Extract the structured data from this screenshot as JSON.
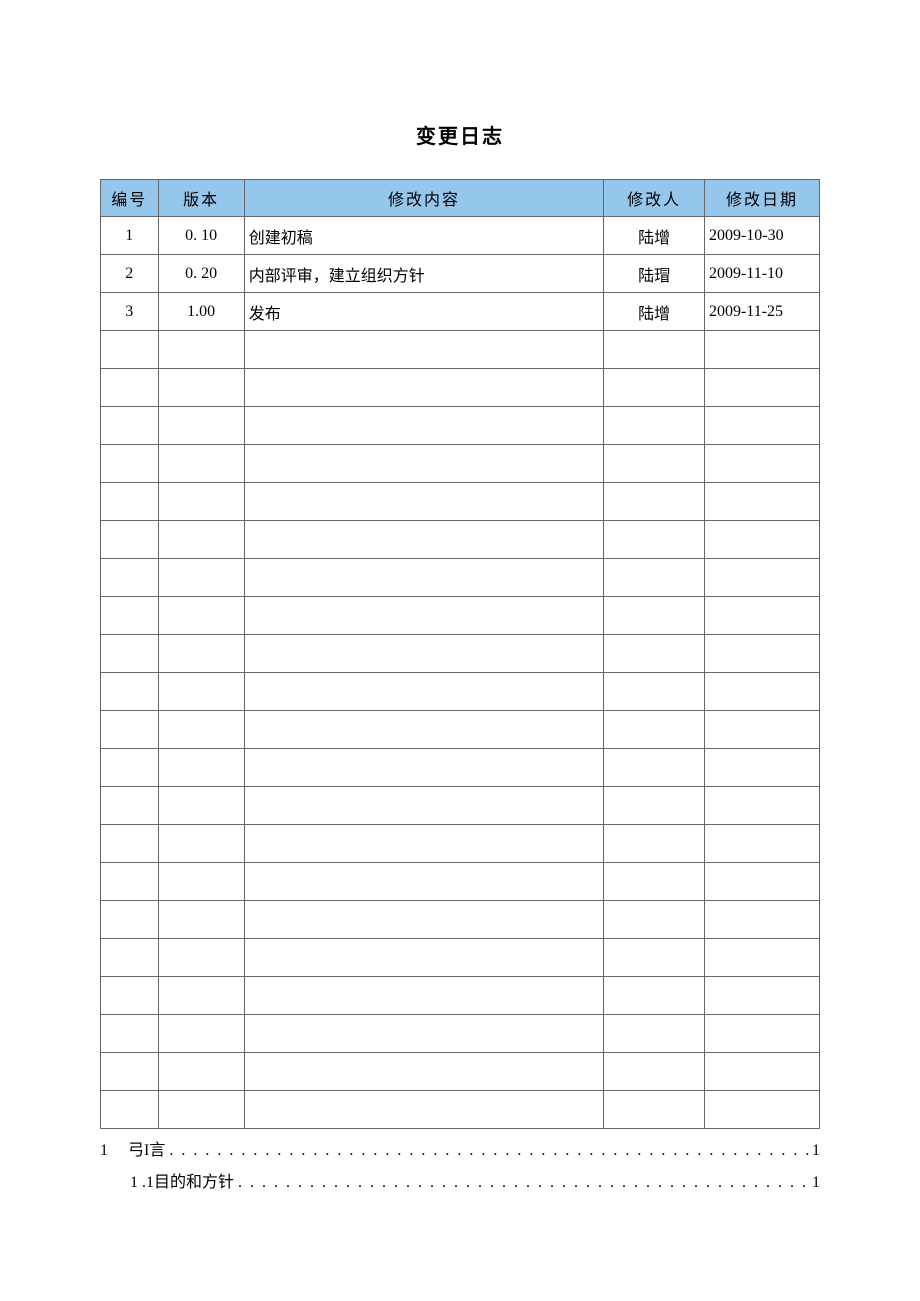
{
  "title": "变更日志",
  "table": {
    "headers": {
      "id": "编号",
      "version": "版本",
      "content": "修改内容",
      "author": "修改人",
      "date": "修改日期"
    },
    "rows": [
      {
        "id": "1",
        "version": "0. 10",
        "content": "创建初稿",
        "author": "陆增",
        "date": "2009-10-30"
      },
      {
        "id": "2",
        "version": "0. 20",
        "content": "内部评审，建立组织方针",
        "author": "陆瑁",
        "date": "2009-11-10"
      },
      {
        "id": "3",
        "version": "1.00",
        "content": "发布",
        "author": "陆增",
        "date": "2009-11-25"
      },
      {
        "id": "",
        "version": "",
        "content": "",
        "author": "",
        "date": ""
      },
      {
        "id": "",
        "version": "",
        "content": "",
        "author": "",
        "date": ""
      },
      {
        "id": "",
        "version": "",
        "content": "",
        "author": "",
        "date": ""
      },
      {
        "id": "",
        "version": "",
        "content": "",
        "author": "",
        "date": ""
      },
      {
        "id": "",
        "version": "",
        "content": "",
        "author": "",
        "date": ""
      },
      {
        "id": "",
        "version": "",
        "content": "",
        "author": "",
        "date": ""
      },
      {
        "id": "",
        "version": "",
        "content": "",
        "author": "",
        "date": ""
      },
      {
        "id": "",
        "version": "",
        "content": "",
        "author": "",
        "date": ""
      },
      {
        "id": "",
        "version": "",
        "content": "",
        "author": "",
        "date": ""
      },
      {
        "id": "",
        "version": "",
        "content": "",
        "author": "",
        "date": ""
      },
      {
        "id": "",
        "version": "",
        "content": "",
        "author": "",
        "date": ""
      },
      {
        "id": "",
        "version": "",
        "content": "",
        "author": "",
        "date": ""
      },
      {
        "id": "",
        "version": "",
        "content": "",
        "author": "",
        "date": ""
      },
      {
        "id": "",
        "version": "",
        "content": "",
        "author": "",
        "date": ""
      },
      {
        "id": "",
        "version": "",
        "content": "",
        "author": "",
        "date": ""
      },
      {
        "id": "",
        "version": "",
        "content": "",
        "author": "",
        "date": ""
      },
      {
        "id": "",
        "version": "",
        "content": "",
        "author": "",
        "date": ""
      },
      {
        "id": "",
        "version": "",
        "content": "",
        "author": "",
        "date": ""
      },
      {
        "id": "",
        "version": "",
        "content": "",
        "author": "",
        "date": ""
      },
      {
        "id": "",
        "version": "",
        "content": "",
        "author": "",
        "date": ""
      },
      {
        "id": "",
        "version": "",
        "content": "",
        "author": "",
        "date": ""
      }
    ]
  },
  "toc": [
    {
      "level": 1,
      "num": "1",
      "label": "弓I言",
      "page": "1"
    },
    {
      "level": 2,
      "num": "1 .1",
      "label": "目的和方针",
      "page": "1"
    }
  ]
}
